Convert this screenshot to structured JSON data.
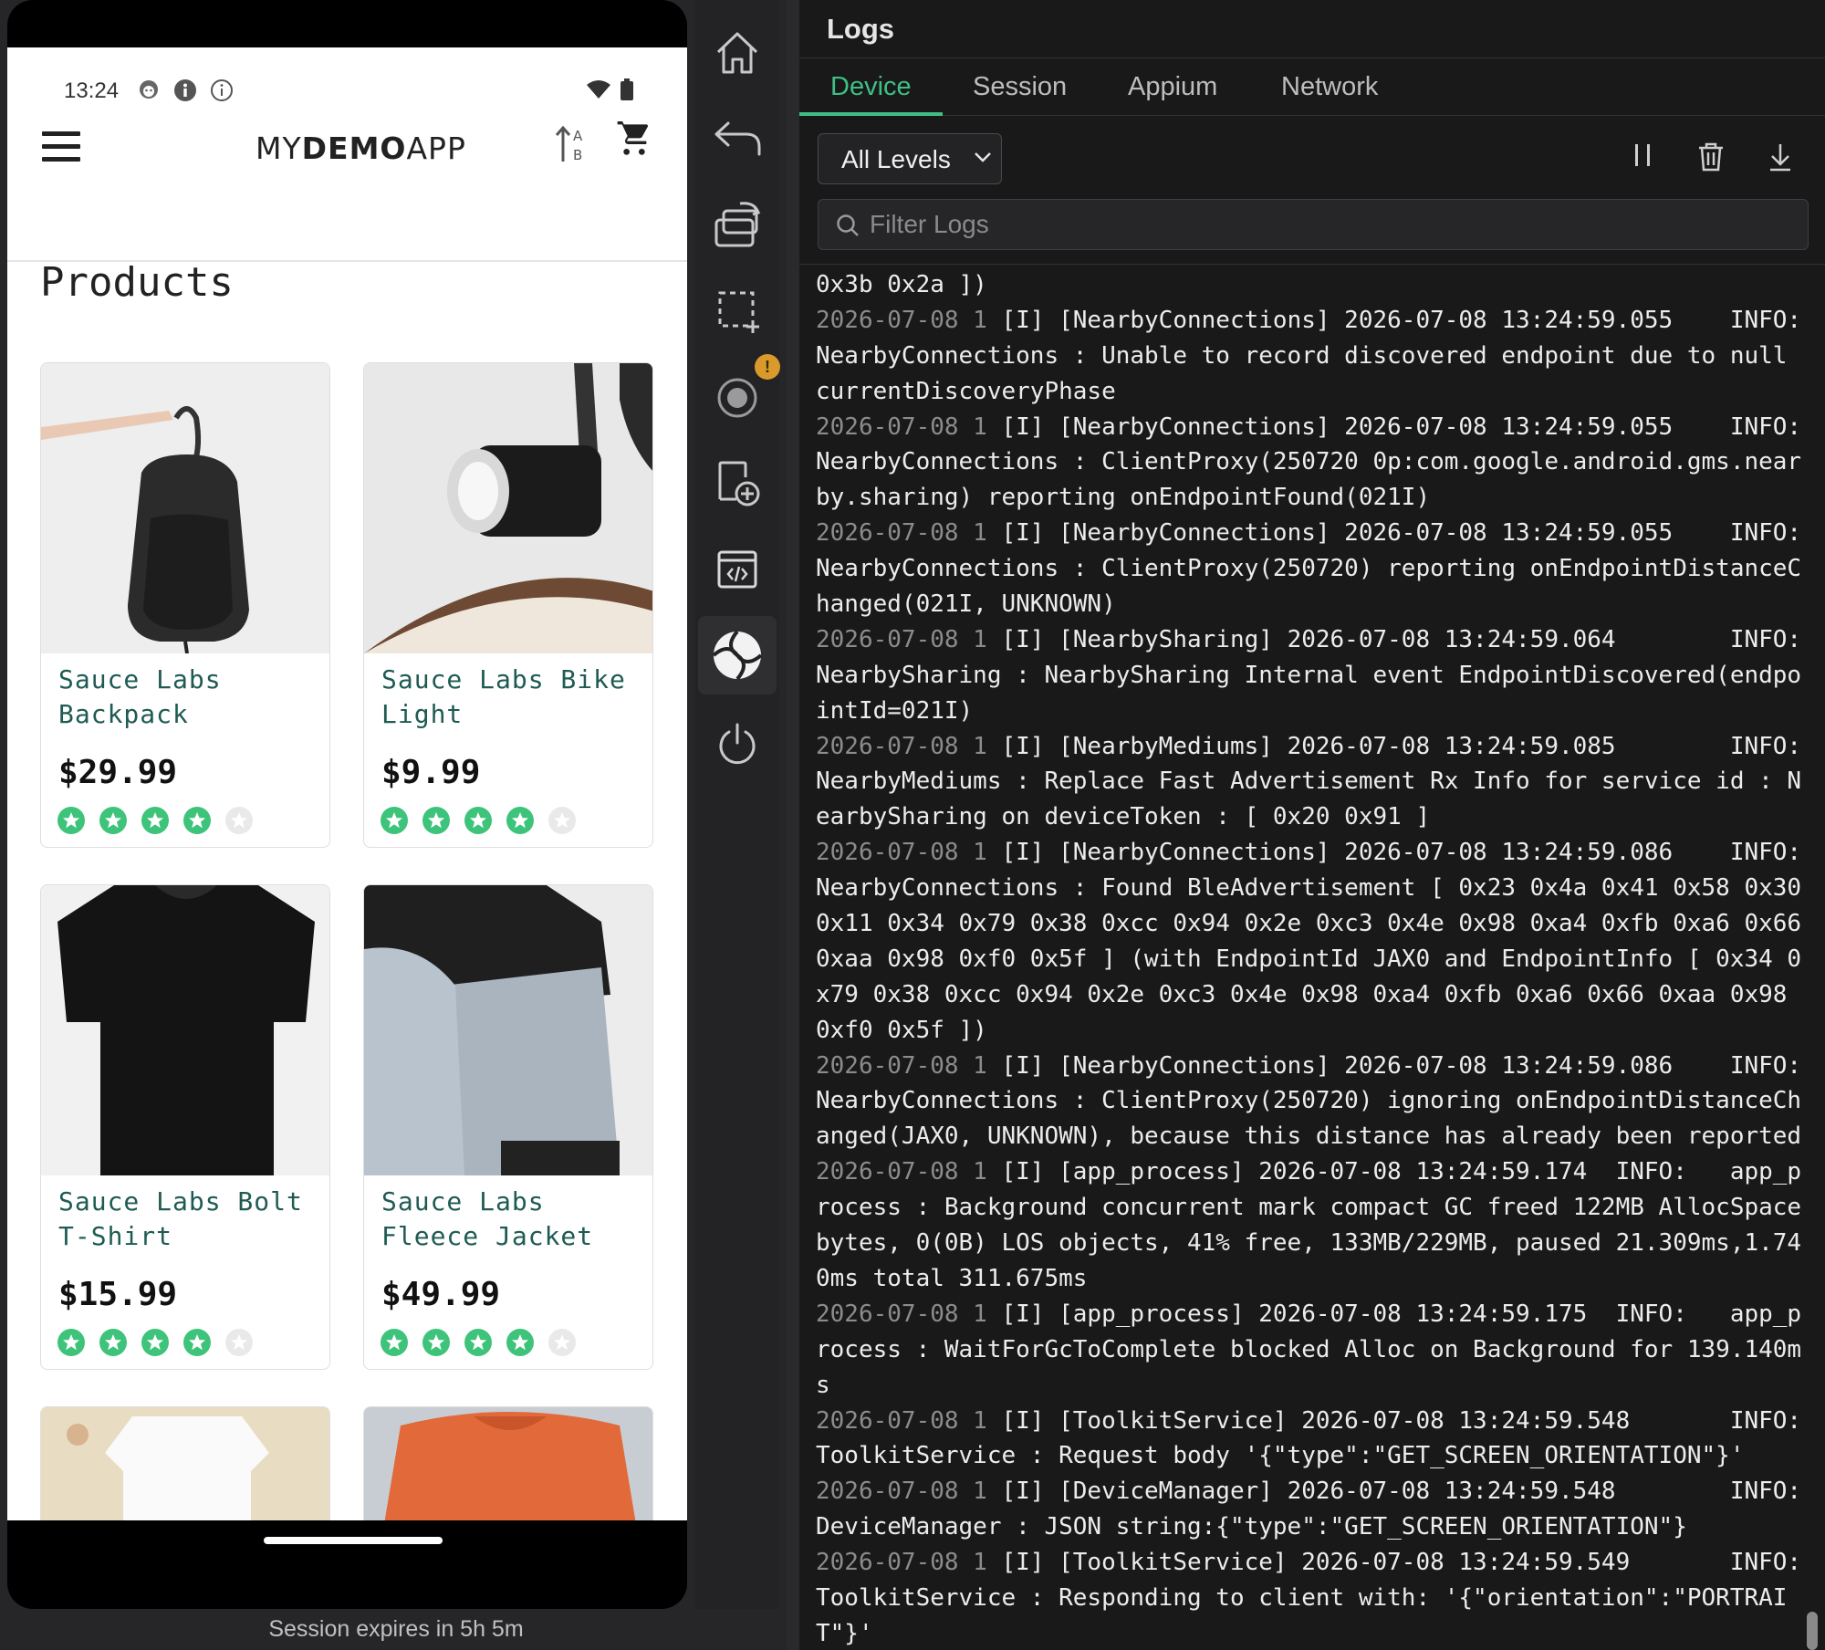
{
  "device": {
    "status_time": "13:24",
    "app_logo_parts": [
      "MY",
      "DEMO",
      "APP"
    ],
    "page_title": "Products",
    "products": [
      {
        "name": "Sauce Labs Backpack",
        "price": "$29.99",
        "rating": 4
      },
      {
        "name": "Sauce Labs Bike Light",
        "price": "$9.99",
        "rating": 4
      },
      {
        "name": "Sauce Labs Bolt T-Shirt",
        "price": "$15.99",
        "rating": 4
      },
      {
        "name": "Sauce Labs Fleece Jacket",
        "price": "$49.99",
        "rating": 4
      }
    ],
    "rating_max": 5,
    "session_expires": "Session expires in 5h 5m"
  },
  "toolbar": {
    "icons": [
      "home-icon",
      "back-icon",
      "rotate-icon",
      "screenshot-region-icon",
      "record-icon",
      "install-app-icon",
      "inspector-icon",
      "aperture-icon",
      "power-icon"
    ],
    "record_badge": "!",
    "accent": "#3fbf83"
  },
  "logs": {
    "title": "Logs",
    "tabs": [
      "Device",
      "Session",
      "Appium",
      "Network"
    ],
    "active_tab": "Device",
    "level_select": "All Levels",
    "filter_placeholder": "Filter Logs",
    "lines": [
      {
        "ts": "",
        "text": "0x3b 0x2a ])"
      },
      {
        "ts": "2026-07-08 1",
        "text": " [I] [NearbyConnections] 2026-07-08 13:24:59.055    INFO:"
      },
      {
        "ts": "",
        "text": "NearbyConnections : Unable to record discovered endpoint due to null"
      },
      {
        "ts": "",
        "text": "currentDiscoveryPhase"
      },
      {
        "ts": "2026-07-08 1",
        "text": " [I] [NearbyConnections] 2026-07-08 13:24:59.055    INFO:"
      },
      {
        "ts": "",
        "text": "NearbyConnections : ClientProxy(250720 0p:com.google.android.gms.near"
      },
      {
        "ts": "",
        "text": "by.sharing) reporting onEndpointFound(021I)"
      },
      {
        "ts": "2026-07-08 1",
        "text": " [I] [NearbyConnections] 2026-07-08 13:24:59.055    INFO:"
      },
      {
        "ts": "",
        "text": "NearbyConnections : ClientProxy(250720) reporting onEndpointDistanceC"
      },
      {
        "ts": "",
        "text": "hanged(021I, UNKNOWN)"
      },
      {
        "ts": "2026-07-08 1",
        "text": " [I] [NearbySharing] 2026-07-08 13:24:59.064        INFO:"
      },
      {
        "ts": "",
        "text": "NearbySharing : NearbySharing Internal event EndpointDiscovered(endpo"
      },
      {
        "ts": "",
        "text": "intId=021I)"
      },
      {
        "ts": "2026-07-08 1",
        "text": " [I] [NearbyMediums] 2026-07-08 13:24:59.085        INFO:"
      },
      {
        "ts": "",
        "text": "NearbyMediums : Replace Fast Advertisement Rx Info for service id : N"
      },
      {
        "ts": "",
        "text": "earbySharing on deviceToken : [ 0x20 0x91 ]"
      },
      {
        "ts": "2026-07-08 1",
        "text": " [I] [NearbyConnections] 2026-07-08 13:24:59.086    INFO:"
      },
      {
        "ts": "",
        "text": "NearbyConnections : Found BleAdvertisement [ 0x23 0x4a 0x41 0x58 0x30"
      },
      {
        "ts": "",
        "text": "0x11 0x34 0x79 0x38 0xcc 0x94 0x2e 0xc3 0x4e 0x98 0xa4 0xfb 0xa6 0x66"
      },
      {
        "ts": "",
        "text": "0xaa 0x98 0xf0 0x5f ] (with EndpointId JAX0 and EndpointInfo [ 0x34 0"
      },
      {
        "ts": "",
        "text": "x79 0x38 0xcc 0x94 0x2e 0xc3 0x4e 0x98 0xa4 0xfb 0xa6 0x66 0xaa 0x98"
      },
      {
        "ts": "",
        "text": "0xf0 0x5f ])"
      },
      {
        "ts": "2026-07-08 1",
        "text": " [I] [NearbyConnections] 2026-07-08 13:24:59.086    INFO:"
      },
      {
        "ts": "",
        "text": "NearbyConnections : ClientProxy(250720) ignoring onEndpointDistanceCh"
      },
      {
        "ts": "",
        "text": "anged(JAX0, UNKNOWN), because this distance has already been reported"
      },
      {
        "ts": "2026-07-08 1",
        "text": " [I] [app_process] 2026-07-08 13:24:59.174  INFO:   app_p"
      },
      {
        "ts": "",
        "text": "rocess : Background concurrent mark compact GC freed 122MB AllocSpace"
      },
      {
        "ts": "",
        "text": "bytes, 0(0B) LOS objects, 41% free, 133MB/229MB, paused 21.309ms,1.74"
      },
      {
        "ts": "",
        "text": "0ms total 311.675ms"
      },
      {
        "ts": "2026-07-08 1",
        "text": " [I] [app_process] 2026-07-08 13:24:59.175  INFO:   app_p"
      },
      {
        "ts": "",
        "text": "rocess : WaitForGcToComplete blocked Alloc on Background for 139.140m"
      },
      {
        "ts": "",
        "text": "s"
      },
      {
        "ts": "2026-07-08 1",
        "text": " [I] [ToolkitService] 2026-07-08 13:24:59.548       INFO:"
      },
      {
        "ts": "",
        "text": "ToolkitService : Request body '{\"type\":\"GET_SCREEN_ORIENTATION\"}'"
      },
      {
        "ts": "2026-07-08 1",
        "text": " [I] [DeviceManager] 2026-07-08 13:24:59.548        INFO:"
      },
      {
        "ts": "",
        "text": "DeviceManager : JSON string:{\"type\":\"GET_SCREEN_ORIENTATION\"}"
      },
      {
        "ts": "2026-07-08 1",
        "text": " [I] [ToolkitService] 2026-07-08 13:24:59.549       INFO:"
      },
      {
        "ts": "",
        "text": "ToolkitService : Responding to client with: '{\"orientation\":\"PORTRAI"
      },
      {
        "ts": "",
        "text": "T\"}'"
      }
    ]
  }
}
